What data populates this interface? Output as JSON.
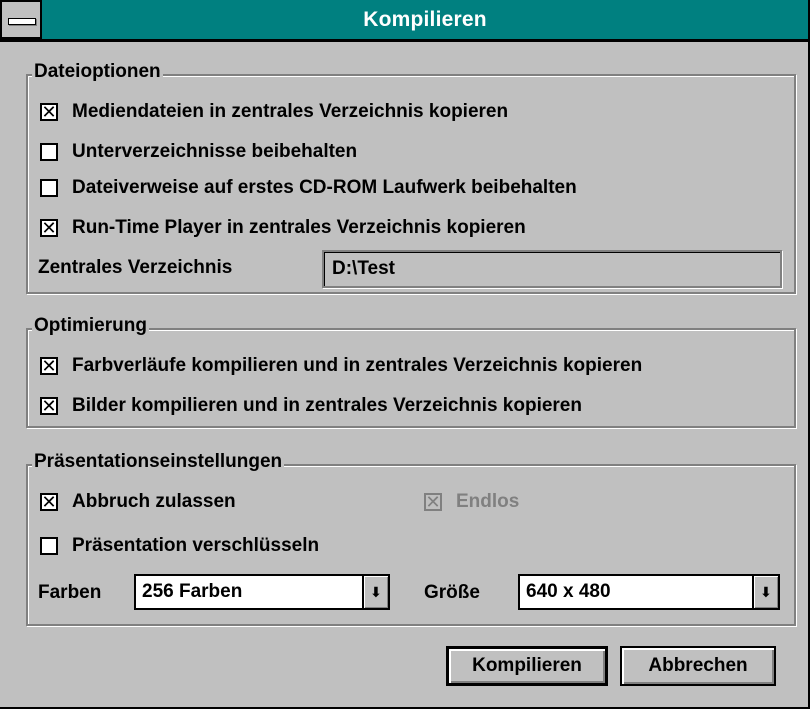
{
  "window": {
    "title": "Kompilieren"
  },
  "dateioptionen": {
    "title": "Dateioptionen",
    "options": [
      {
        "label": "Mediendateien in zentrales Verzeichnis kopieren",
        "checked": true
      },
      {
        "label": "Unterverzeichnisse beibehalten",
        "checked": false
      },
      {
        "label": "Dateiverweise auf erstes CD-ROM Laufwerk beibehalten",
        "checked": false
      },
      {
        "label": "Run-Time Player in zentrales Verzeichnis kopieren",
        "checked": true
      }
    ],
    "central_dir_label": "Zentrales Verzeichnis",
    "central_dir_value": "D:\\Test"
  },
  "optimierung": {
    "title": "Optimierung",
    "options": [
      {
        "label": "Farbverläufe kompilieren und in zentrales Verzeichnis kopieren",
        "checked": true
      },
      {
        "label": "Bilder kompilieren und in zentrales Verzeichnis kopieren",
        "checked": true
      }
    ]
  },
  "praesentation": {
    "title": "Präsentationseinstellungen",
    "abbruch": {
      "label": "Abbruch zulassen",
      "checked": true
    },
    "endlos": {
      "label": "Endlos",
      "checked": true,
      "disabled": true
    },
    "verschluesseln": {
      "label": "Präsentation verschlüsseln",
      "checked": false
    },
    "farben_label": "Farben",
    "farben_value": "256 Farben",
    "groesse_label": "Größe",
    "groesse_value": "640 x 480"
  },
  "buttons": {
    "compile": "Kompilieren",
    "cancel": "Abbrechen"
  }
}
